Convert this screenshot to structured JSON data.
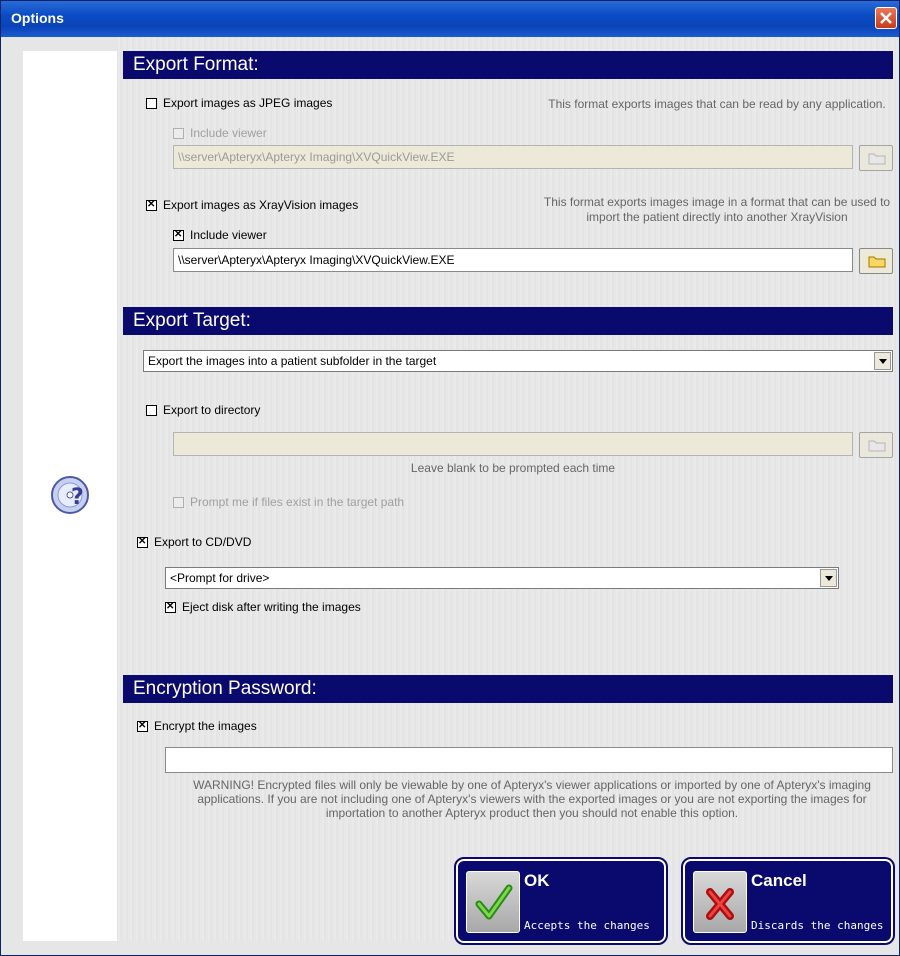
{
  "window": {
    "title": "Options"
  },
  "export_format": {
    "header": "Export Format:",
    "jpeg": {
      "label": "Export images as JPEG images",
      "checked": false,
      "description": "This format exports images that can be read by any application.",
      "include_viewer_label": "Include viewer",
      "include_viewer_checked": false,
      "viewer_path": "\\\\server\\Apteryx\\Apteryx Imaging\\XVQuickView.EXE"
    },
    "xrayvision": {
      "label": "Export images as XrayVision images",
      "checked": true,
      "description": "This format exports images image in a format that can be used to import the patient directly into another XrayVision",
      "include_viewer_label": "Include viewer",
      "include_viewer_checked": true,
      "viewer_path": "\\\\server\\Apteryx\\Apteryx Imaging\\XVQuickView.EXE"
    }
  },
  "export_target": {
    "header": "Export Target:",
    "mode_selected": "Export the images into a patient subfolder in the target",
    "directory_label": "Export to directory",
    "directory_checked": false,
    "directory_value": "",
    "directory_note": "Leave blank to be prompted each time",
    "prompt_label": "Prompt me if files exist in the target path",
    "prompt_checked": false,
    "cd_label": "Export to CD/DVD",
    "cd_checked": true,
    "drive_selected": "<Prompt for drive>",
    "eject_label": "Eject disk after writing the images",
    "eject_checked": true
  },
  "encryption": {
    "header": "Encryption Password:",
    "encrypt_label": "Encrypt the images",
    "encrypt_checked": true,
    "password_value": "",
    "warning": "WARNING!  Encrypted files will only be viewable by one of Apteryx's viewer applications or imported by one of Apteryx's imaging applications.  If you are not including one of Apteryx's viewers with the exported images or you are not exporting the images for importation to another Apteryx product then you should not enable this option."
  },
  "buttons": {
    "ok_label": "OK",
    "ok_sub": "Accepts the changes",
    "cancel_label": "Cancel",
    "cancel_sub": "Discards the changes"
  },
  "icons": {
    "help": "help-cd-icon",
    "close": "close-icon",
    "browse": "folder-icon",
    "ok": "checkmark-icon",
    "cancel": "x-mark-icon"
  },
  "colors": {
    "header_bg": "#0a0a6e",
    "titlebar": "#0a4bc4",
    "close": "#d9542b"
  }
}
